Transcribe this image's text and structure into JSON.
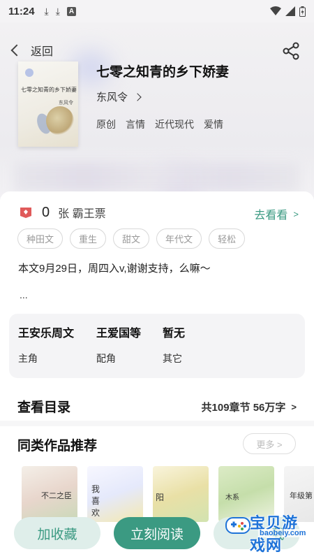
{
  "status_bar": {
    "time": "11:24"
  },
  "nav": {
    "back_label": "返回"
  },
  "book": {
    "title": "七零之知青的乡下娇妻",
    "author": "东风令",
    "tags": [
      "原创",
      "言情",
      "近代现代",
      "爱情"
    ],
    "cover_title": "七零之知青的乡下娇妻",
    "cover_author": "东风令"
  },
  "tickets": {
    "count": "0",
    "label": "张 霸王票",
    "go_see": "去看看",
    "go_see_chevron": ">"
  },
  "keywords": [
    "种田文",
    "重生",
    "甜文",
    "年代文",
    "轻松"
  ],
  "description": "本文9月29日，周四入v,谢谢支持，么嘛～",
  "ellipsis": "...",
  "roles": [
    {
      "name": "王安乐周文",
      "type": "主角"
    },
    {
      "name": "王爱国等",
      "type": "配角"
    },
    {
      "name": "暂无",
      "type": "其它"
    }
  ],
  "toc": {
    "title": "查看目录",
    "info": "共109章节 56万字",
    "chevron": ">"
  },
  "recommend": {
    "title": "同类作品推荐",
    "more": "更多 >",
    "covers": [
      {
        "text": "不二之臣"
      },
      {
        "text": "我喜欢"
      },
      {
        "text": "阳"
      },
      {
        "text": "木系"
      },
      {
        "text": "年级第"
      }
    ]
  },
  "bottom": {
    "favorite": "加收藏",
    "read_now": "立刻阅读",
    "download": "载"
  },
  "watermark": {
    "name": "宝贝游戏网",
    "url": "baobeiy.com"
  }
}
